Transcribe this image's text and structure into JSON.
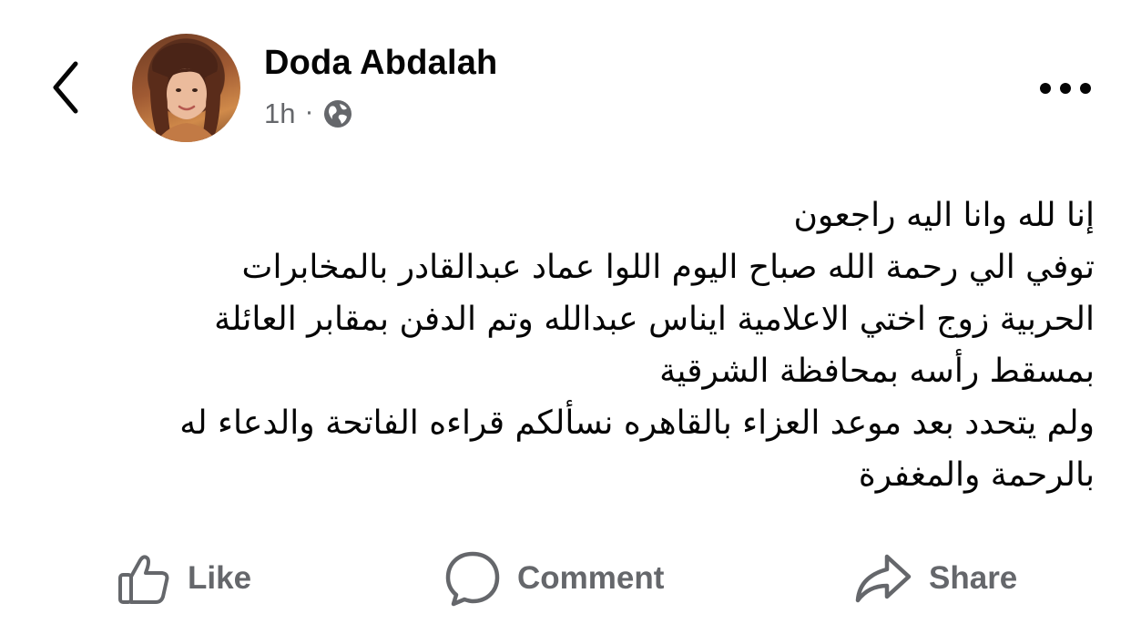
{
  "header": {
    "back_icon": "chevron-left-icon",
    "author_name": "Doda Abdalah",
    "time": "1h",
    "separator": "·",
    "audience_icon": "globe-icon",
    "more_icon": "more-horizontal-icon"
  },
  "post": {
    "lines": [
      "إنا لله وانا اليه راجعون",
      "توفي الي رحمة الله  صباح اليوم اللوا عماد عبدالقادر بالمخابرات",
      "الحربية زوج اختي الاعلامية ايناس عبدالله وتم الدفن بمقابر العائلة",
      "بمسقط رأسه بمحافظة الشرقية",
      "ولم يتحدد بعد موعد العزاء بالقاهره نسألكم قراءه الفاتحة والدعاء له",
      "بالرحمة والمغفرة"
    ]
  },
  "actions": {
    "like_label": "Like",
    "comment_label": "Comment",
    "share_label": "Share"
  },
  "colors": {
    "text_primary": "#050505",
    "text_secondary": "#65676b",
    "background": "#ffffff"
  }
}
